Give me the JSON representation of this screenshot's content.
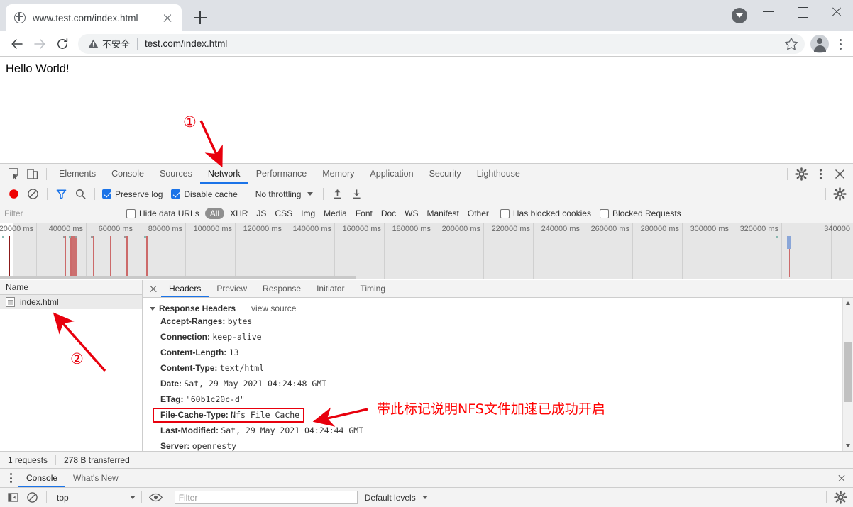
{
  "browser": {
    "tab": {
      "title": "www.test.com/index.html",
      "favicon": "globe-icon",
      "close": "×"
    },
    "newtab_tooltip": "New Tab",
    "nav": {
      "back": "back-arrow",
      "forward": "forward-arrow",
      "reload": "reload-icon"
    },
    "omnibox": {
      "security_text": "不安全",
      "url": "test.com/index.html",
      "star": "bookmark-star-icon"
    },
    "window": {
      "minimize": "−",
      "maximize": "□",
      "close": "✕"
    }
  },
  "page": {
    "body_text": "Hello World!"
  },
  "devtools": {
    "tabs": [
      {
        "label": "Elements",
        "active": false
      },
      {
        "label": "Console",
        "active": false
      },
      {
        "label": "Sources",
        "active": false
      },
      {
        "label": "Network",
        "active": true
      },
      {
        "label": "Performance",
        "active": false
      },
      {
        "label": "Memory",
        "active": false
      },
      {
        "label": "Application",
        "active": false
      },
      {
        "label": "Security",
        "active": false
      },
      {
        "label": "Lighthouse",
        "active": false
      }
    ],
    "network_toolbar": {
      "record": "record-icon",
      "clear": "clear-icon",
      "filter": "funnel-icon",
      "search": "search-icon",
      "preserve_log": {
        "label": "Preserve log",
        "checked": true
      },
      "disable_cache": {
        "label": "Disable cache",
        "checked": true
      },
      "throttling": "No throttling",
      "import_har": "import-icon",
      "export_har": "export-icon",
      "settings": "gear-icon"
    },
    "filter_bar": {
      "filter_placeholder": "Filter",
      "hide_data_urls": {
        "label": "Hide data URLs",
        "checked": false
      },
      "types": [
        "All",
        "XHR",
        "JS",
        "CSS",
        "Img",
        "Media",
        "Font",
        "Doc",
        "WS",
        "Manifest",
        "Other"
      ],
      "active_type": "All",
      "has_blocked_cookies": {
        "label": "Has blocked cookies",
        "checked": false
      },
      "blocked_requests": {
        "label": "Blocked Requests",
        "checked": false
      }
    },
    "overview": {
      "ticks": [
        "20000 ms",
        "40000 ms",
        "60000 ms",
        "80000 ms",
        "100000 ms",
        "120000 ms",
        "140000 ms",
        "160000 ms",
        "180000 ms",
        "200000 ms",
        "220000 ms",
        "240000 ms",
        "260000 ms",
        "280000 ms",
        "300000 ms",
        "320000 ms",
        "340000"
      ]
    },
    "request_list": {
      "column_header": "Name",
      "rows": [
        {
          "name": "index.html",
          "icon": "document-icon",
          "selected": true
        }
      ]
    },
    "detail": {
      "close": "×",
      "tabs": [
        {
          "label": "Headers",
          "active": true
        },
        {
          "label": "Preview",
          "active": false
        },
        {
          "label": "Response",
          "active": false
        },
        {
          "label": "Initiator",
          "active": false
        },
        {
          "label": "Timing",
          "active": false
        }
      ],
      "section_title": "Response Headers",
      "view_source": "view source",
      "headers": [
        {
          "key": "Accept-Ranges:",
          "value": "bytes",
          "highlight": false
        },
        {
          "key": "Connection:",
          "value": "keep-alive",
          "highlight": false
        },
        {
          "key": "Content-Length:",
          "value": "13",
          "highlight": false
        },
        {
          "key": "Content-Type:",
          "value": "text/html",
          "highlight": false
        },
        {
          "key": "Date:",
          "value": "Sat, 29 May 2021 04:24:48 GMT",
          "highlight": false
        },
        {
          "key": "ETag:",
          "value": "\"60b1c20c-d\"",
          "highlight": false
        },
        {
          "key": "File-Cache-Type:",
          "value": "Nfs File Cache",
          "highlight": true
        },
        {
          "key": "Last-Modified:",
          "value": "Sat, 29 May 2021 04:24:44 GMT",
          "highlight": false
        },
        {
          "key": "Server:",
          "value": "openresty",
          "highlight": false
        }
      ]
    },
    "status_bar": {
      "requests": "1 requests",
      "transferred": "278 B transferred"
    }
  },
  "drawer": {
    "tabs": [
      {
        "label": "Console",
        "active": true
      },
      {
        "label": "What's New",
        "active": false
      }
    ],
    "close": "×",
    "toolbar": {
      "sidebar_toggle": "sidebar-icon",
      "clear": "clear-icon",
      "context": "top",
      "eye": "eye-icon",
      "filter_placeholder": "Filter",
      "levels": "Default levels",
      "settings": "gear-icon"
    }
  },
  "annotations": {
    "marker_one": "①",
    "marker_two": "②",
    "note_text": "带此标记说明NFS文件加速已成功开启",
    "arrow_color": "#e8000d",
    "highlight_color": "#e8000d",
    "note_color": "#ff0000"
  },
  "colors": {
    "accent": "#1a73e8",
    "record_red": "#ee0000",
    "chrome_tabstrip": "#dee1e6",
    "devtools_bg": "#f3f3f3"
  }
}
